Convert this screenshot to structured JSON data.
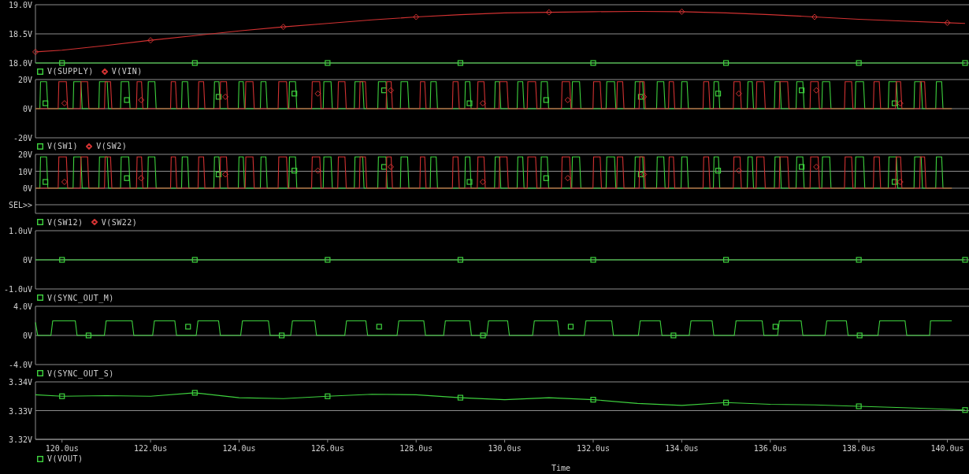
{
  "panels": [
    {
      "kind": "smooth",
      "y_labels": [
        "19.0V",
        "18.5V",
        "18.0V"
      ],
      "traces": [
        {
          "name": "V(SUPPLY)",
          "color": "#3ed23e",
          "kind": "square"
        },
        {
          "name": "V(VIN)",
          "color": "#d23232",
          "kind": "diamond"
        }
      ]
    },
    {
      "kind": "switching",
      "y_labels": [
        "20V",
        "0V",
        "-20V"
      ],
      "traces": [
        {
          "name": "V(SW1)",
          "color": "#3ed23e",
          "kind": "square"
        },
        {
          "name": "V(SW2)",
          "color": "#d23232",
          "kind": "diamond"
        }
      ]
    },
    {
      "kind": "switching",
      "y_labels": [
        "20V",
        "10V",
        "0V"
      ],
      "selector_label": "SEL>>",
      "traces": [
        {
          "name": "V(SW12)",
          "color": "#3ed23e",
          "kind": "square"
        },
        {
          "name": "V(SW22)",
          "color": "#d23232",
          "kind": "diamond"
        }
      ]
    },
    {
      "kind": "flat",
      "y_labels": [
        "1.0uV",
        "0V",
        "-1.0uV"
      ],
      "traces": [
        {
          "name": "V(SYNC_OUT_M)",
          "color": "#3ed23e",
          "kind": "square"
        }
      ]
    },
    {
      "kind": "pulse",
      "y_labels": [
        "4.0V",
        "0V",
        "-4.0V"
      ],
      "traces": [
        {
          "name": "V(SYNC_OUT_S)",
          "color": "#3ed23e",
          "kind": "square"
        }
      ]
    },
    {
      "kind": "ripple",
      "y_labels": [
        "3.34V",
        "3.33V",
        "3.32V"
      ],
      "traces": [
        {
          "name": "V(VOUT)",
          "color": "#3ed23e",
          "kind": "square"
        }
      ]
    }
  ],
  "x_axis": {
    "ticks": [
      "120.0us",
      "122.0us",
      "124.0us",
      "126.0us",
      "128.0us",
      "130.0us",
      "132.0us",
      "134.0us",
      "136.0us",
      "138.0us",
      "140.0us"
    ],
    "title": "Time"
  }
}
